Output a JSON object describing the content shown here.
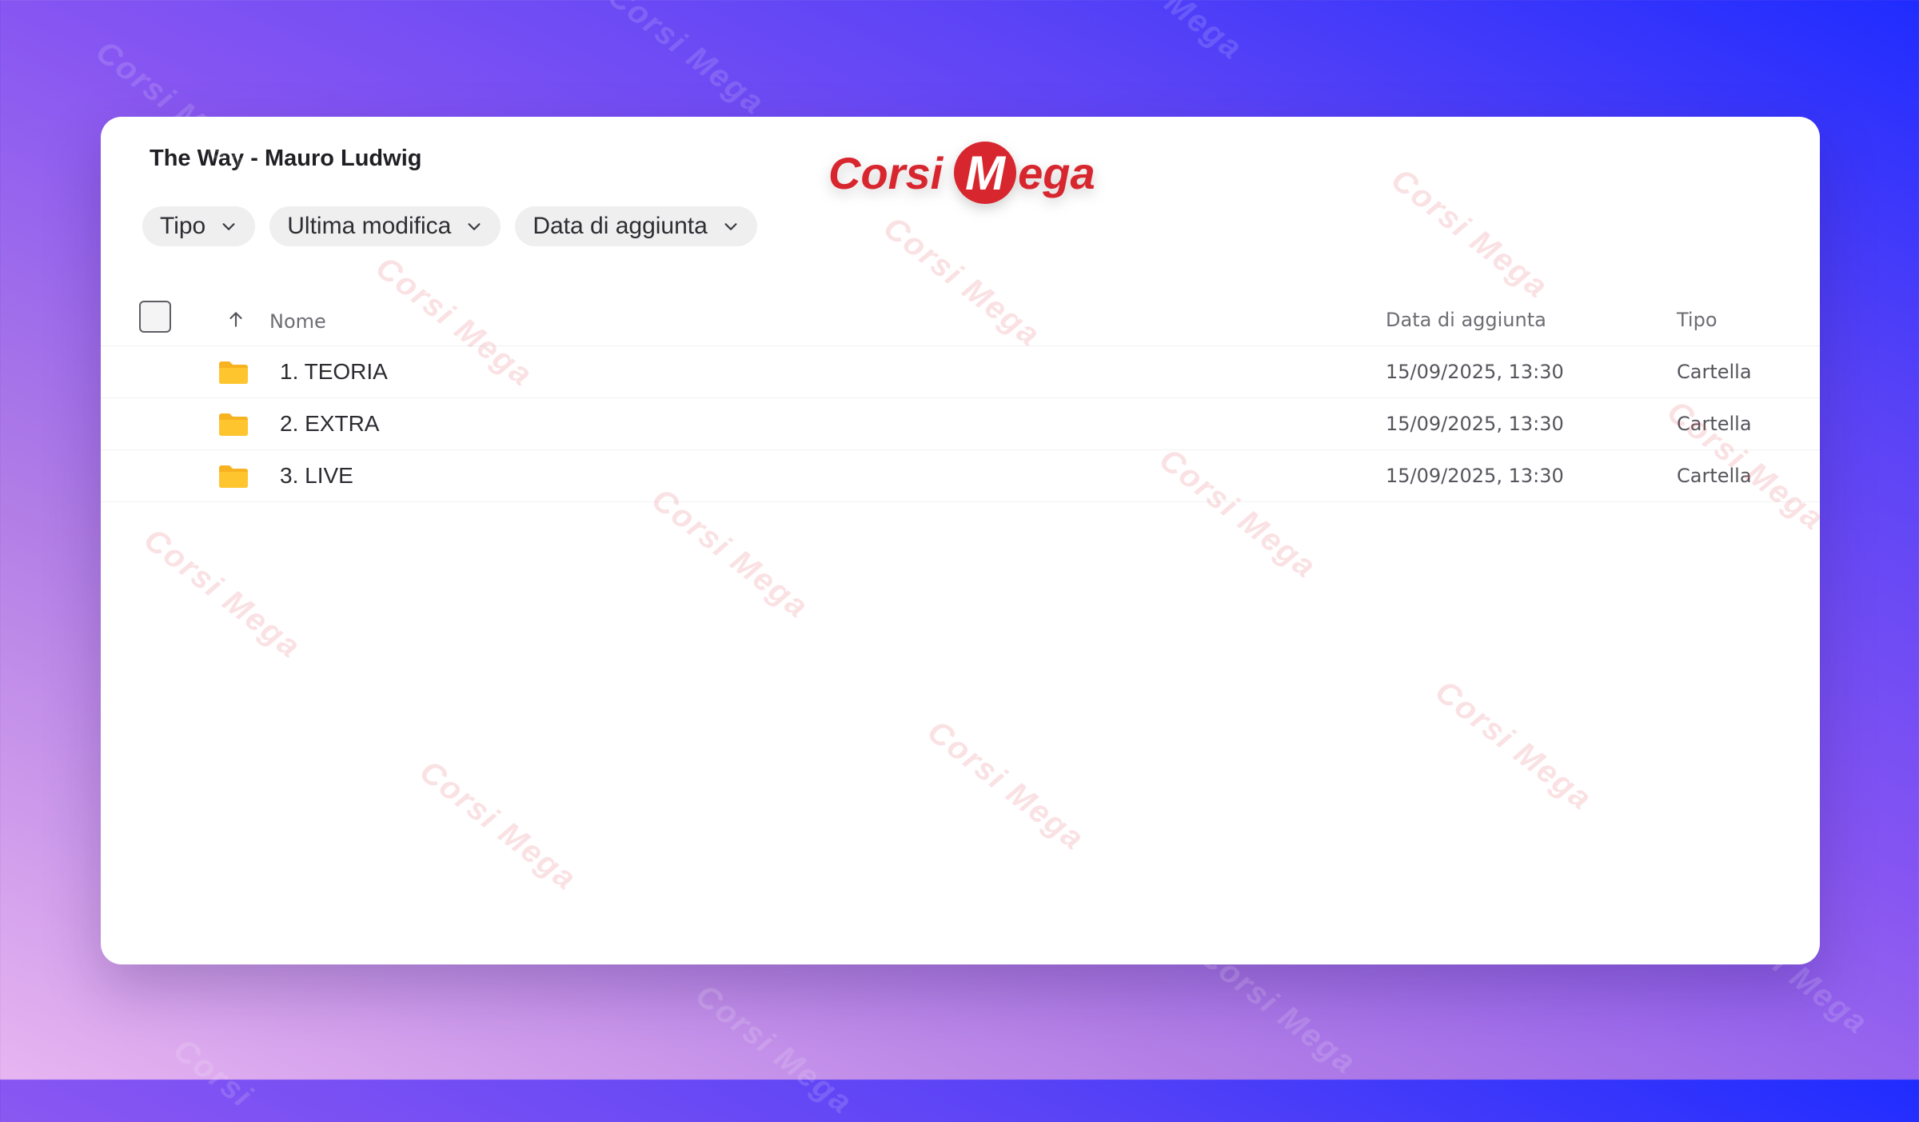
{
  "title": "The Way - Mauro Ludwig",
  "logo": {
    "text_left": "Corsi",
    "text_m": "M",
    "text_right": "ega",
    "color": "#d8262f"
  },
  "filters": [
    {
      "label": "Tipo",
      "icon": "chevron-down-icon"
    },
    {
      "label": "Ultima modifica",
      "icon": "chevron-down-icon"
    },
    {
      "label": "Data di aggiunta",
      "icon": "chevron-down-icon"
    }
  ],
  "table": {
    "columns": {
      "name": "Nome",
      "date": "Data di aggiunta",
      "type": "Tipo"
    },
    "sort_icon": "arrow-up-icon",
    "rows": [
      {
        "icon": "folder-icon",
        "name": "1. TEORIA",
        "date": "15/09/2025, 13:30",
        "type": "Cartella"
      },
      {
        "icon": "folder-icon",
        "name": "2. EXTRA",
        "date": "15/09/2025, 13:30",
        "type": "Cartella"
      },
      {
        "icon": "folder-icon",
        "name": "3. LIVE",
        "date": "15/09/2025, 13:30",
        "type": "Cartella"
      }
    ]
  },
  "colors": {
    "folder": "#f7b21f",
    "accent": "#d8262f"
  }
}
